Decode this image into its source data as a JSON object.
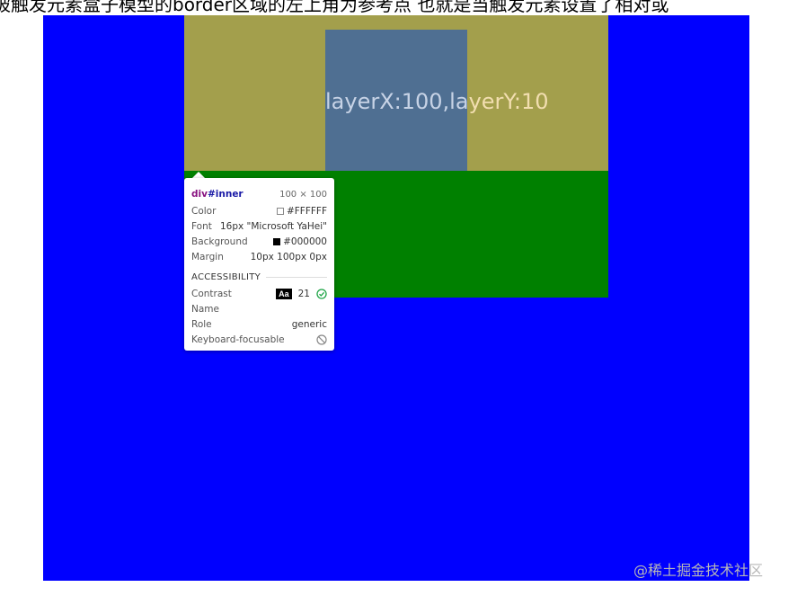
{
  "page": {
    "top_text": "被触发元素盒子模型的border区域的左上角为参考点 也就是当触发元素设置了相对或"
  },
  "demo": {
    "layer_text_main": "layerX:100,la",
    "layer_text_over": "yerY:10"
  },
  "tooltip": {
    "tag": "div",
    "id": "#inner",
    "size": "100 × 100",
    "rows": [
      {
        "label": "Color",
        "value": "#FFFFFF",
        "swatch": "#FFFFFF"
      },
      {
        "label": "Font",
        "value": "16px \"Microsoft YaHei\""
      },
      {
        "label": "Background",
        "value": "#000000",
        "swatch": "#000000"
      },
      {
        "label": "Margin",
        "value": "10px 100px 0px"
      }
    ],
    "accessibility_title": "ACCESSIBILITY",
    "contrast_label": "Contrast",
    "contrast_badge": "Aa",
    "contrast_value": "21",
    "name_label": "Name",
    "role_label": "Role",
    "role_value": "generic",
    "keyboard_label": "Keyboard-focusable"
  },
  "watermark": "@稀土掘金技术社区",
  "colors": {
    "outer": "#0000ff",
    "middle": "#008000",
    "highlight": "#a39f4c",
    "inner_highlight": "#4f6f92",
    "check": "#1ea446"
  }
}
